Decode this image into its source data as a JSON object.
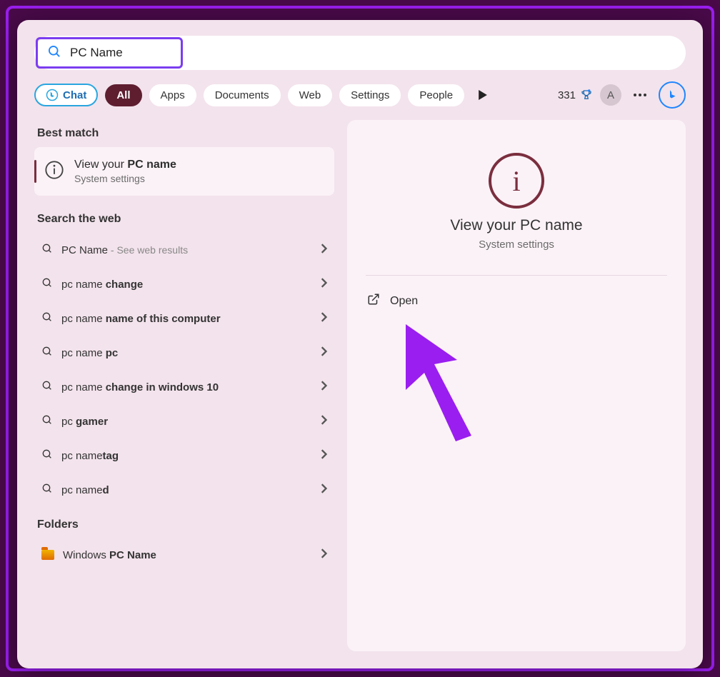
{
  "search": {
    "query": "PC Name"
  },
  "filters": {
    "chat": "Chat",
    "all": "All",
    "apps": "Apps",
    "documents": "Documents",
    "web": "Web",
    "settings": "Settings",
    "people": "People"
  },
  "topbar": {
    "points": "331",
    "avatar_initial": "A"
  },
  "left": {
    "best_match_label": "Best match",
    "best_match": {
      "title_pre": "View your ",
      "title_bold": "PC name",
      "subtitle": "System settings"
    },
    "search_web_label": "Search the web",
    "web_results": [
      {
        "plain": "PC Name",
        "bold": "",
        "tail": " - See web results"
      },
      {
        "plain": "pc name ",
        "bold": "change",
        "tail": ""
      },
      {
        "plain": "pc name ",
        "bold": "name of this computer",
        "tail": ""
      },
      {
        "plain": "pc name ",
        "bold": "pc",
        "tail": ""
      },
      {
        "plain": "pc name ",
        "bold": "change in windows 10",
        "tail": ""
      },
      {
        "plain": "pc ",
        "bold": "gamer",
        "tail": ""
      },
      {
        "plain": "pc name",
        "bold": "tag",
        "tail": ""
      },
      {
        "plain": "pc name",
        "bold": "d",
        "tail": ""
      }
    ],
    "folders_label": "Folders",
    "folders": [
      {
        "plain": "Windows ",
        "bold": "PC Name"
      }
    ]
  },
  "right": {
    "title": "View your PC name",
    "subtitle": "System settings",
    "open_label": "Open"
  }
}
